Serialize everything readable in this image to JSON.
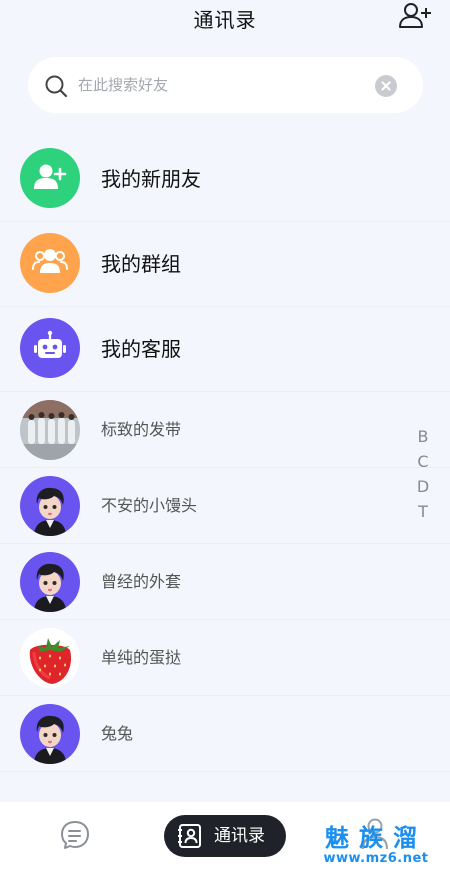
{
  "header": {
    "title": "通讯录",
    "add_friend_icon": "add-user-icon"
  },
  "search": {
    "placeholder": "在此搜索好友",
    "value": "",
    "icon": "search-icon",
    "clear_icon": "clear-icon"
  },
  "specials": [
    {
      "label": "我的新朋友",
      "icon": "add-user-icon",
      "color": "#2ed17c"
    },
    {
      "label": "我的群组",
      "icon": "group-icon",
      "color": "#ffa44c"
    },
    {
      "label": "我的客服",
      "icon": "robot-icon",
      "color": "#6a54f0"
    }
  ],
  "contacts": [
    {
      "name": "标致的发带",
      "avatar": "group-photo"
    },
    {
      "name": "不安的小馒头",
      "avatar": "cartoon-boy"
    },
    {
      "name": "曾经的外套",
      "avatar": "cartoon-boy"
    },
    {
      "name": "单纯的蛋挞",
      "avatar": "strawberry"
    },
    {
      "name": "兔兔",
      "avatar": "cartoon-boy"
    }
  ],
  "index_letters": [
    "B",
    "C",
    "D",
    "T"
  ],
  "tabbar": {
    "chat_icon": "chat-bubble-icon",
    "contacts_label": "通讯录",
    "contacts_icon": "contacts-icon",
    "me_icon": "person-icon"
  },
  "watermark": {
    "big": "魅族溜",
    "small": "www.mz6.net"
  },
  "colors": {
    "background": "#f3f6fd",
    "tab_active_bg": "#1f2329",
    "watermark": "#1a8ff0"
  }
}
